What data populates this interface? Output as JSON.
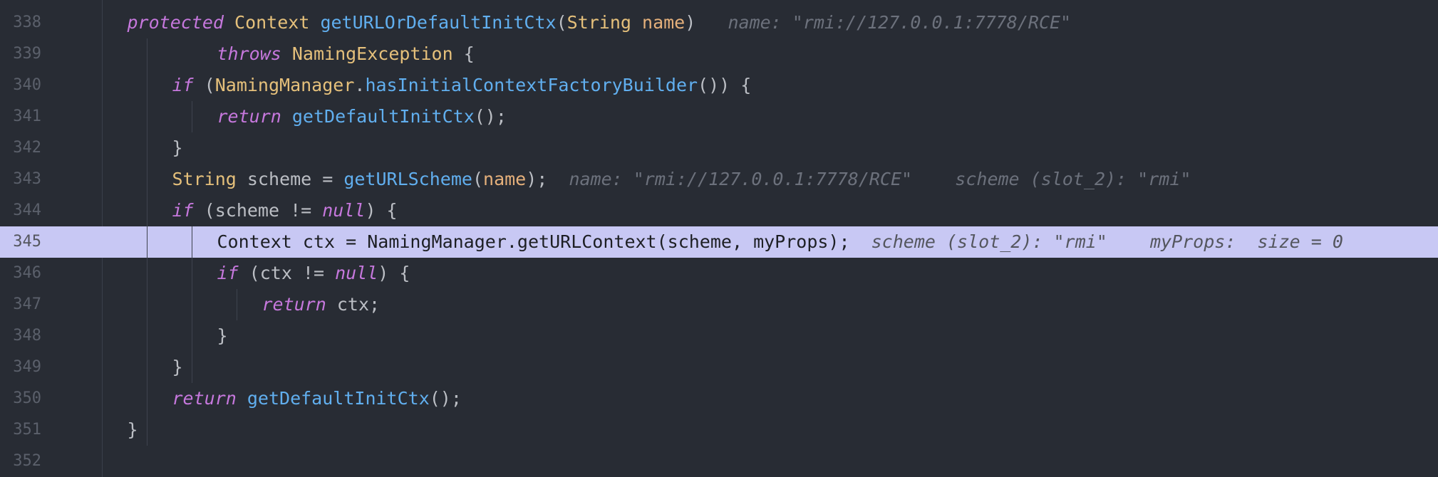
{
  "editor": {
    "lines": [
      {
        "num": "338",
        "indent": 1,
        "tokens": [
          {
            "t": "protected",
            "c": "kw"
          },
          {
            "t": " ",
            "c": "tx"
          },
          {
            "t": "Context",
            "c": "ty"
          },
          {
            "t": " ",
            "c": "tx"
          },
          {
            "t": "getURLOrDefaultInitCtx",
            "c": "fn"
          },
          {
            "t": "(",
            "c": "tx"
          },
          {
            "t": "String",
            "c": "ty"
          },
          {
            "t": " ",
            "c": "tx"
          },
          {
            "t": "name",
            "c": "pn"
          },
          {
            "t": ")",
            "c": "tx"
          },
          {
            "t": "   name: \"rmi://127.0.0.1:7778/RCE\"",
            "c": "hint"
          }
        ]
      },
      {
        "num": "339",
        "indent": 5,
        "tokens": [
          {
            "t": "throws",
            "c": "kw"
          },
          {
            "t": " ",
            "c": "tx"
          },
          {
            "t": "NamingException",
            "c": "ty"
          },
          {
            "t": " {",
            "c": "tx"
          }
        ]
      },
      {
        "num": "340",
        "indent": 3,
        "tokens": [
          {
            "t": "if",
            "c": "kw"
          },
          {
            "t": " (",
            "c": "tx"
          },
          {
            "t": "NamingManager",
            "c": "ty"
          },
          {
            "t": ".",
            "c": "tx"
          },
          {
            "t": "hasInitialContextFactoryBuilder",
            "c": "fn"
          },
          {
            "t": "()) {",
            "c": "tx"
          }
        ]
      },
      {
        "num": "341",
        "indent": 5,
        "tokens": [
          {
            "t": "return",
            "c": "kw"
          },
          {
            "t": " ",
            "c": "tx"
          },
          {
            "t": "getDefaultInitCtx",
            "c": "fn"
          },
          {
            "t": "();",
            "c": "tx"
          }
        ]
      },
      {
        "num": "342",
        "indent": 3,
        "tokens": [
          {
            "t": "}",
            "c": "tx"
          }
        ]
      },
      {
        "num": "343",
        "indent": 3,
        "tokens": [
          {
            "t": "String",
            "c": "ty"
          },
          {
            "t": " scheme = ",
            "c": "tx"
          },
          {
            "t": "getURLScheme",
            "c": "fn"
          },
          {
            "t": "(",
            "c": "tx"
          },
          {
            "t": "name",
            "c": "pn"
          },
          {
            "t": ");",
            "c": "tx"
          },
          {
            "t": "  name: \"rmi://127.0.0.1:7778/RCE\"    scheme (slot_2): \"rmi\"",
            "c": "hint"
          }
        ]
      },
      {
        "num": "344",
        "indent": 3,
        "tokens": [
          {
            "t": "if",
            "c": "kw"
          },
          {
            "t": " (scheme != ",
            "c": "tx"
          },
          {
            "t": "null",
            "c": "kw"
          },
          {
            "t": ") {",
            "c": "tx"
          }
        ]
      },
      {
        "num": "345",
        "indent": 5,
        "highlight": true,
        "tokens": [
          {
            "t": "Context ctx = NamingManager.getURLContext(scheme, myProps);",
            "c": "code-text"
          },
          {
            "t": "  scheme (slot_2): \"rmi\"    myProps:  size = 0",
            "c": "hint"
          }
        ]
      },
      {
        "num": "346",
        "indent": 5,
        "tokens": [
          {
            "t": "if",
            "c": "kw"
          },
          {
            "t": " (ctx != ",
            "c": "tx"
          },
          {
            "t": "null",
            "c": "kw"
          },
          {
            "t": ") {",
            "c": "tx"
          }
        ]
      },
      {
        "num": "347",
        "indent": 7,
        "tokens": [
          {
            "t": "return",
            "c": "kw"
          },
          {
            "t": " ctx;",
            "c": "tx"
          }
        ]
      },
      {
        "num": "348",
        "indent": 5,
        "tokens": [
          {
            "t": "}",
            "c": "tx"
          }
        ]
      },
      {
        "num": "349",
        "indent": 3,
        "tokens": [
          {
            "t": "}",
            "c": "tx"
          }
        ]
      },
      {
        "num": "350",
        "indent": 3,
        "tokens": [
          {
            "t": "return",
            "c": "kw"
          },
          {
            "t": " ",
            "c": "tx"
          },
          {
            "t": "getDefaultInitCtx",
            "c": "fn"
          },
          {
            "t": "();",
            "c": "tx"
          }
        ]
      },
      {
        "num": "351",
        "indent": 1,
        "tokens": [
          {
            "t": "}",
            "c": "tx"
          }
        ]
      },
      {
        "num": "352",
        "indent": 0,
        "tokens": []
      }
    ]
  }
}
